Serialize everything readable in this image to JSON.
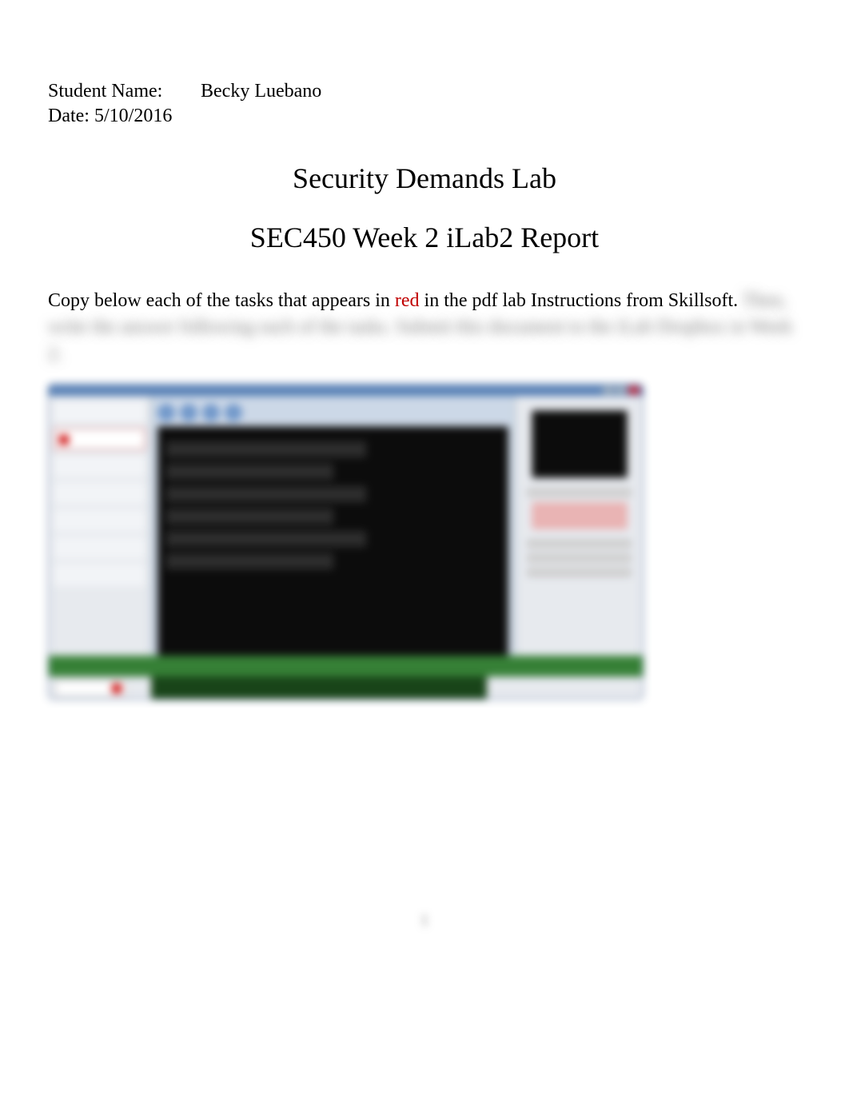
{
  "header": {
    "name_label": "Student Name:",
    "name_value": "Becky Luebano",
    "date_label": "Date:",
    "date_value": "5/10/2016"
  },
  "titles": {
    "main": "Security Demands Lab",
    "sub": "SEC450 Week 2 iLab2 Report"
  },
  "intro": {
    "part1": "Copy below each of the tasks that appears in ",
    "red_word": "red",
    "part2": " in the pdf lab Instructions from Skillsoft.",
    "blurred_line": "Then, write the answer following each of the tasks. Submit this document to the iLab Dropbox in Week 2."
  },
  "footer": {
    "page_number": "1"
  },
  "colors": {
    "red_text": "#c00000",
    "window_chrome": "#3a6aa8",
    "status_green": "#2c7a2c"
  }
}
